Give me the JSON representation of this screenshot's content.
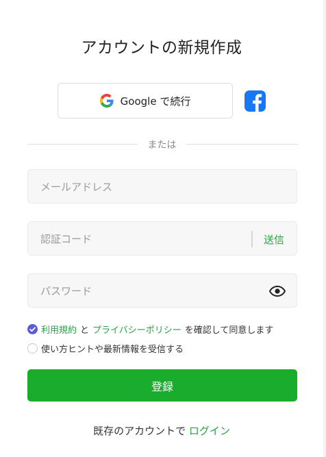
{
  "title": "アカウントの新規作成",
  "social": {
    "google_label": "Google で続行",
    "google_icon": "google-icon",
    "facebook_icon": "facebook-icon"
  },
  "divider_text": "または",
  "form": {
    "email_placeholder": "メールアドレス",
    "code_placeholder": "認証コード",
    "send_label": "送信",
    "password_placeholder": "パスワード",
    "eye_icon": "eye-icon"
  },
  "consent": {
    "checked": true,
    "terms_link": "利用規約",
    "and": "と",
    "privacy_link": "プライバシーポリシー",
    "suffix": "を確認して同意します"
  },
  "tips": {
    "checked": false,
    "label": "使い方ヒントや最新情報を受信する"
  },
  "register_label": "登録",
  "login_prompt": {
    "text": "既存のアカウントで",
    "link": "ログイン"
  },
  "colors": {
    "accent_green": "#1aac2c",
    "link_green": "#2aa043",
    "checkbox_purple": "#5b5bd6",
    "facebook_blue": "#1877f2"
  }
}
